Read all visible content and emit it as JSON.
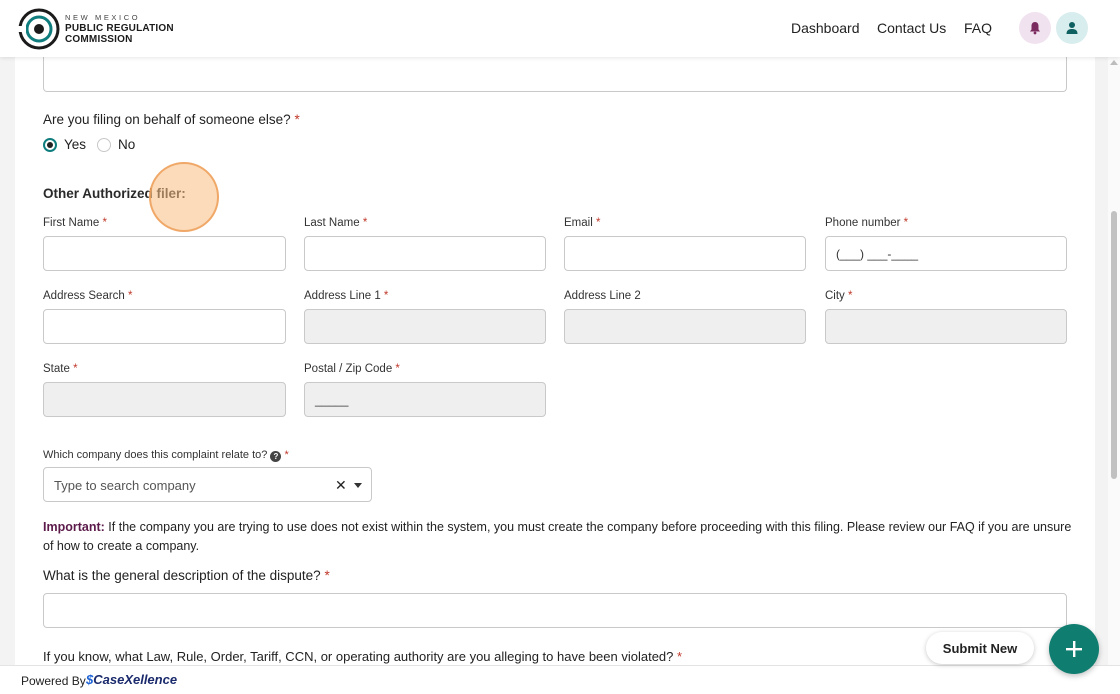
{
  "header": {
    "brand_line1": "NEW MEXICO",
    "brand_line2": "PUBLIC REGULATION",
    "brand_line3": "COMMISSION",
    "nav": [
      "Dashboard",
      "Contact Us",
      "FAQ"
    ],
    "icons": [
      "bell-icon",
      "user-icon"
    ]
  },
  "form": {
    "behalf_question": "Are you filing on behalf of someone else?",
    "required_mark": "*",
    "behalf_options": [
      {
        "label": "Yes",
        "selected": true
      },
      {
        "label": "No",
        "selected": false
      }
    ],
    "section_title": "Other Authorized filer:",
    "fields": {
      "first_name": {
        "label": "First Name",
        "value": ""
      },
      "last_name": {
        "label": "Last Name",
        "value": ""
      },
      "email": {
        "label": "Email",
        "value": ""
      },
      "phone": {
        "label": "Phone number",
        "value": "(___) ___-____"
      },
      "address_search": {
        "label": "Address Search",
        "value": ""
      },
      "address_line1": {
        "label": "Address Line 1",
        "value": ""
      },
      "address_line2": {
        "label": "Address Line 2",
        "value": ""
      },
      "city": {
        "label": "City",
        "value": ""
      },
      "state": {
        "label": "State",
        "value": ""
      },
      "zip": {
        "label": "Postal / Zip Code",
        "value": "_____"
      }
    },
    "company_question": "Which company does this complaint relate to?",
    "company_placeholder": "Type to search company",
    "company_clear": "✕",
    "important_label": "Important:",
    "important_text_line1": "If the company you are trying to use does not exist within the system, you must create the company before proceeding with this filing. Please review our FAQ if you are unsure",
    "important_text_line2": "of how to create a company.",
    "important_color": "#5b1a4a",
    "dispute_question": "What is the general description of the dispute?",
    "law_question": "If you know, what Law, Rule, Order, Tariff, CCN, or operating authority are you alleging to have been violated?"
  },
  "actions": {
    "submit_new": "Submit New",
    "fab_icon": "plus-icon"
  },
  "footer": {
    "powered_by": "Powered By",
    "brand": "CaseXellence"
  },
  "colors": {
    "accent": "#0f7d6f",
    "bell_bg": "#f1e2ef",
    "user_bg": "#d8eded",
    "required": "#c0392b"
  }
}
